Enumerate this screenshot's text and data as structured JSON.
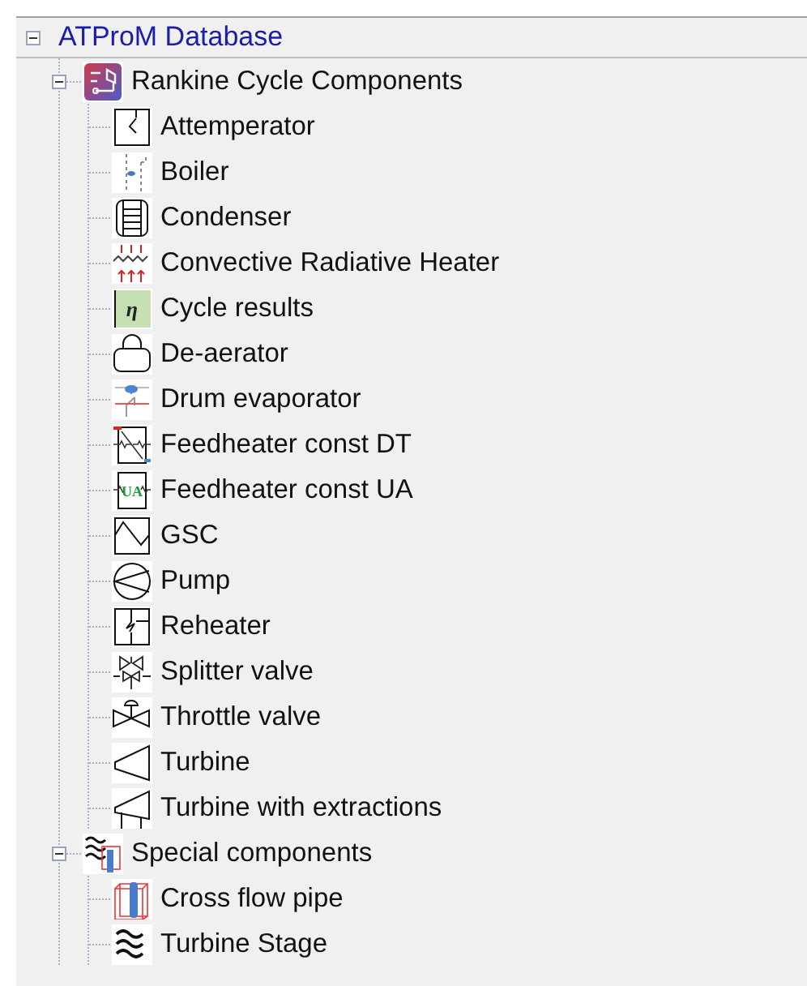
{
  "tree": {
    "label": "ATProM Database",
    "expanded": true,
    "children": [
      {
        "label": "Rankine Cycle Components",
        "kind": "rankine",
        "expanded": true,
        "children": [
          {
            "label": "Attemperator",
            "kind": "attemperator"
          },
          {
            "label": "Boiler",
            "kind": "boiler"
          },
          {
            "label": "Condenser",
            "kind": "condenser"
          },
          {
            "label": "Convective Radiative Heater",
            "kind": "heater"
          },
          {
            "label": "Cycle results",
            "kind": "results",
            "icon_text": "η"
          },
          {
            "label": "De-aerator",
            "kind": "deaerator"
          },
          {
            "label": "Drum evaporator",
            "kind": "drum"
          },
          {
            "label": "Feedheater const DT",
            "kind": "feeddt"
          },
          {
            "label": "Feedheater const UA",
            "kind": "feedua",
            "icon_text": "UA"
          },
          {
            "label": "GSC",
            "kind": "gsc"
          },
          {
            "label": "Pump",
            "kind": "pump"
          },
          {
            "label": "Reheater",
            "kind": "reheater"
          },
          {
            "label": "Splitter valve",
            "kind": "splitter"
          },
          {
            "label": "Throttle valve",
            "kind": "throttle"
          },
          {
            "label": "Turbine",
            "kind": "turbine"
          },
          {
            "label": "Turbine with extractions",
            "kind": "turbinex"
          }
        ]
      },
      {
        "label": "Special components",
        "kind": "special",
        "expanded": true,
        "children": [
          {
            "label": "Cross flow pipe",
            "kind": "pipe"
          },
          {
            "label": "Turbine Stage",
            "kind": "stage"
          }
        ]
      }
    ]
  }
}
